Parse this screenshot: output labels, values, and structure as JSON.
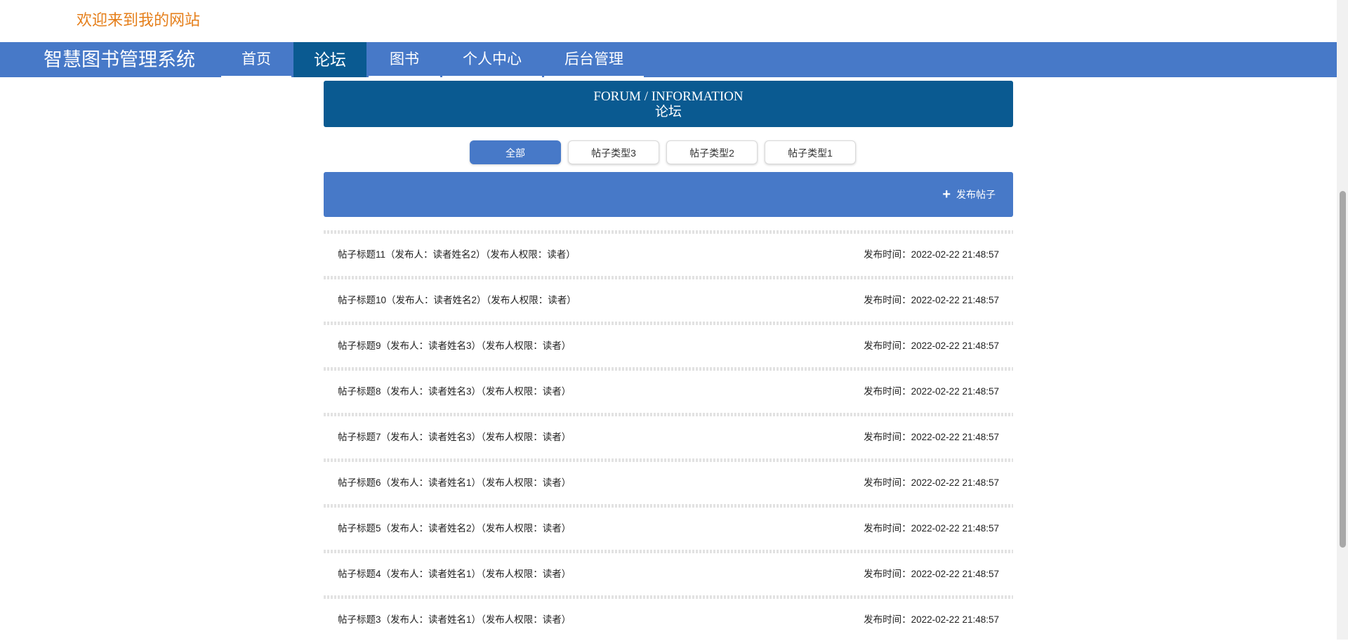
{
  "header": {
    "welcome": "欢迎来到我的网站"
  },
  "nav": {
    "brand": "智慧图书管理系统",
    "items": [
      {
        "label": "首页"
      },
      {
        "label": "论坛"
      },
      {
        "label": "图书"
      },
      {
        "label": "个人中心"
      },
      {
        "label": "后台管理"
      }
    ],
    "active": "论坛"
  },
  "forum": {
    "title_en": "FORUM / INFORMATION",
    "title_cn": "论坛"
  },
  "filters": {
    "items": [
      {
        "label": "全部"
      },
      {
        "label": "帖子类型3"
      },
      {
        "label": "帖子类型2"
      },
      {
        "label": "帖子类型1"
      }
    ],
    "active": "全部"
  },
  "toolbar": {
    "publish_label": "发布帖子",
    "publish_icon": "plus-icon"
  },
  "posts": [
    {
      "title": "帖子标题11（发布人：读者姓名2）（发布人权限：读者）",
      "time": "发布时间：2022-02-22 21:48:57"
    },
    {
      "title": "帖子标题10（发布人：读者姓名2）（发布人权限：读者）",
      "time": "发布时间：2022-02-22 21:48:57"
    },
    {
      "title": "帖子标题9（发布人：读者姓名3）（发布人权限：读者）",
      "time": "发布时间：2022-02-22 21:48:57"
    },
    {
      "title": "帖子标题8（发布人：读者姓名3）（发布人权限：读者）",
      "time": "发布时间：2022-02-22 21:48:57"
    },
    {
      "title": "帖子标题7（发布人：读者姓名3）（发布人权限：读者）",
      "time": "发布时间：2022-02-22 21:48:57"
    },
    {
      "title": "帖子标题6（发布人：读者姓名1）（发布人权限：读者）",
      "time": "发布时间：2022-02-22 21:48:57"
    },
    {
      "title": "帖子标题5（发布人：读者姓名2）（发布人权限：读者）",
      "time": "发布时间：2022-02-22 21:48:57"
    },
    {
      "title": "帖子标题4（发布人：读者姓名1）（发布人权限：读者）",
      "time": "发布时间：2022-02-22 21:48:57"
    },
    {
      "title": "帖子标题3（发布人：读者姓名1）（发布人权限：读者）",
      "time": "发布时间：2022-02-22 21:48:57"
    }
  ]
}
